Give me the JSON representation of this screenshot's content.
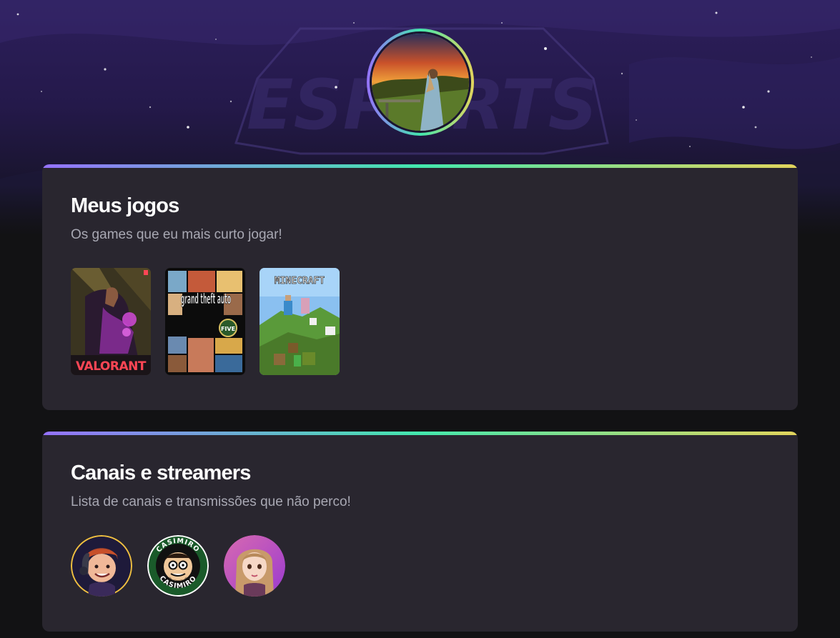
{
  "header": {
    "background_watermark": "ESPORTS",
    "profile_avatar": "profile-photo-sunset"
  },
  "games_section": {
    "title": "Meus jogos",
    "subtitle": "Os games que eu mais curto jogar!",
    "games": [
      {
        "name": "VALORANT"
      },
      {
        "name": "grand theft auto",
        "badge": "FIVE"
      },
      {
        "name": "MINECRAFT"
      }
    ]
  },
  "streamers_section": {
    "title": "Canais e streamers",
    "subtitle": "Lista de canais e transmissões que não perco!",
    "streamers": [
      {
        "avatar": "streamer-1-avatar"
      },
      {
        "avatar": "casimiro-avatar",
        "ring_text": "CASIMIRO"
      },
      {
        "avatar": "streamer-3-avatar"
      }
    ]
  },
  "colors": {
    "background": "#121214",
    "card": "#29262f",
    "gradient": [
      "#9572fc",
      "#43e7ad",
      "#e2d45c"
    ],
    "subtitle": "#a8a8b3"
  }
}
